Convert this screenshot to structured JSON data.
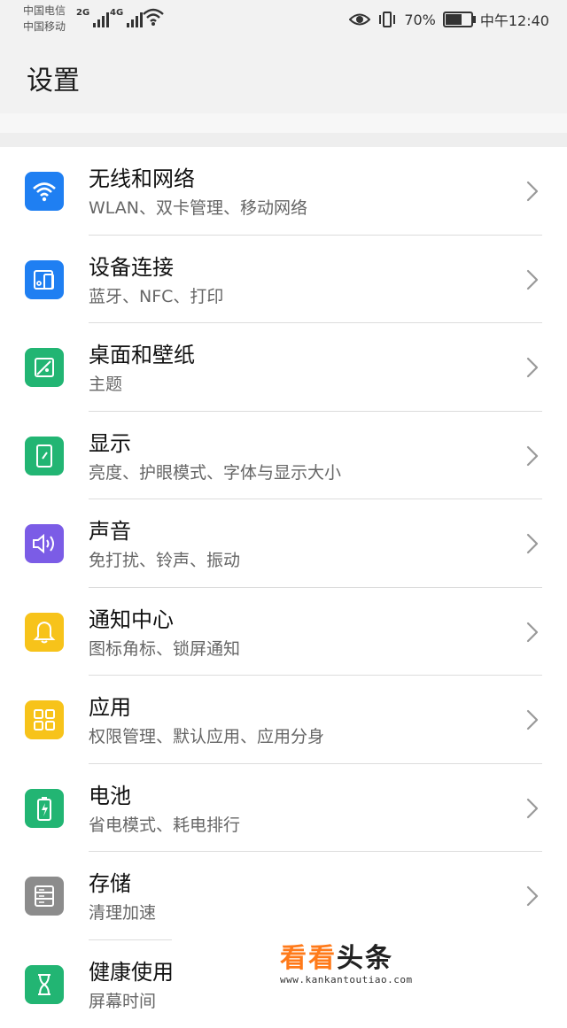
{
  "status_bar": {
    "carrier_1": "中国电信",
    "carrier_2": "中国移动",
    "network_1": "2G",
    "network_2": "4G",
    "battery_percent": "70%",
    "battery_level": 0.7,
    "time": "中午12:40"
  },
  "header": {
    "title": "设置"
  },
  "settings": [
    {
      "title": "无线和网络",
      "subtitle": "WLAN、双卡管理、移动网络",
      "icon": "wifi-icon",
      "color": "#1f7ff2"
    },
    {
      "title": "设备连接",
      "subtitle": "蓝牙、NFC、打印",
      "icon": "device-connection-icon",
      "color": "#1f7ff2"
    },
    {
      "title": "桌面和壁纸",
      "subtitle": "主题",
      "icon": "wallpaper-icon",
      "color": "#22b573"
    },
    {
      "title": "显示",
      "subtitle": "亮度、护眼模式、字体与显示大小",
      "icon": "display-icon",
      "color": "#22b573"
    },
    {
      "title": "声音",
      "subtitle": "免打扰、铃声、振动",
      "icon": "sound-icon",
      "color": "#7b5ce6"
    },
    {
      "title": "通知中心",
      "subtitle": "图标角标、锁屏通知",
      "icon": "bell-icon",
      "color": "#f7c31a"
    },
    {
      "title": "应用",
      "subtitle": "权限管理、默认应用、应用分身",
      "icon": "apps-grid-icon",
      "color": "#f7c31a"
    },
    {
      "title": "电池",
      "subtitle": "省电模式、耗电排行",
      "icon": "battery-icon",
      "color": "#22b573"
    },
    {
      "title": "存储",
      "subtitle": "清理加速",
      "icon": "storage-icon",
      "color": "#8c8c8c"
    },
    {
      "title": "健康使用",
      "subtitle": "屏幕时间",
      "icon": "hourglass-icon",
      "color": "#22b573"
    }
  ],
  "watermark": {
    "text_orange": "看看",
    "text_dark": "头条",
    "url": "www.kankantoutiao.com"
  }
}
